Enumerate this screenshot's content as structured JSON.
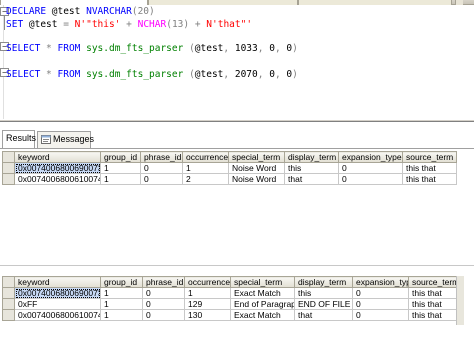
{
  "editor": {
    "lines": [
      {
        "parts": [
          {
            "t": "DECLARE ",
            "c": "kw"
          },
          {
            "t": "@test ",
            "c": ""
          },
          {
            "t": "NVARCHAR",
            "c": "kw"
          },
          {
            "t": "(20)",
            "c": "gray"
          }
        ]
      },
      {
        "parts": [
          {
            "t": "SET ",
            "c": "kw"
          },
          {
            "t": "@test ",
            "c": ""
          },
          {
            "t": "= ",
            "c": "gray"
          },
          {
            "t": "N'\"this' ",
            "c": "str"
          },
          {
            "t": "+ ",
            "c": "gray"
          },
          {
            "t": "NCHAR",
            "c": "fn"
          },
          {
            "t": "(13) ",
            "c": "gray"
          },
          {
            "t": "+ ",
            "c": "gray"
          },
          {
            "t": "N'that\"'",
            "c": "str"
          }
        ]
      },
      {
        "parts": []
      },
      {
        "parts": [
          {
            "t": "SELECT ",
            "c": "kw"
          },
          {
            "t": "* ",
            "c": "gray"
          },
          {
            "t": "FROM ",
            "c": "kw"
          },
          {
            "t": "sys.dm_fts_parser ",
            "c": "obj"
          },
          {
            "t": "(",
            "c": "gray"
          },
          {
            "t": "@test",
            "c": ""
          },
          {
            "t": ", ",
            "c": "gray"
          },
          {
            "t": "1033",
            "c": ""
          },
          {
            "t": ", ",
            "c": "gray"
          },
          {
            "t": "0",
            "c": ""
          },
          {
            "t": ", ",
            "c": "gray"
          },
          {
            "t": "0",
            "c": ""
          },
          {
            "t": ")",
            "c": "gray"
          }
        ]
      },
      {
        "parts": []
      },
      {
        "parts": []
      },
      {
        "parts": [
          {
            "t": "SELECT ",
            "c": "kw"
          },
          {
            "t": "* ",
            "c": "gray"
          },
          {
            "t": "FROM ",
            "c": "kw"
          },
          {
            "t": "sys.dm_fts_parser ",
            "c": "obj"
          },
          {
            "t": "(",
            "c": "gray"
          },
          {
            "t": "@test",
            "c": ""
          },
          {
            "t": ", ",
            "c": "gray"
          },
          {
            "t": "2070",
            "c": ""
          },
          {
            "t": ", ",
            "c": "gray"
          },
          {
            "t": "0",
            "c": ""
          },
          {
            "t": ", ",
            "c": "gray"
          },
          {
            "t": "0",
            "c": ""
          },
          {
            "t": ")",
            "c": "gray"
          }
        ]
      }
    ]
  },
  "results_tabs": {
    "results_label": "Results",
    "messages_label": "Messages"
  },
  "grids": [
    {
      "columns": [
        "keyword",
        "group_id",
        "phrase_id",
        "occurrence",
        "special_term",
        "display_term",
        "expansion_type",
        "source_term"
      ],
      "rows": [
        [
          "0x0074006800690073",
          "1",
          "0",
          "1",
          "Noise Word",
          "this",
          "0",
          "this that"
        ],
        [
          "0x0074006800610074",
          "1",
          "0",
          "2",
          "Noise Word",
          "that",
          "0",
          "this that"
        ]
      ]
    },
    {
      "columns": [
        "keyword",
        "group_id",
        "phrase_id",
        "occurrence",
        "special_term",
        "display_term",
        "expansion_type",
        "source_term"
      ],
      "rows": [
        [
          "0x0074006800690073",
          "1",
          "0",
          "1",
          "Exact Match",
          "this",
          "0",
          "this that"
        ],
        [
          "0xFF",
          "1",
          "0",
          "129",
          "End of Paragraph",
          "END OF FILE",
          "0",
          "this that"
        ],
        [
          "0x0074006800610074",
          "1",
          "0",
          "130",
          "Exact Match",
          "that",
          "0",
          "this that"
        ]
      ]
    }
  ]
}
